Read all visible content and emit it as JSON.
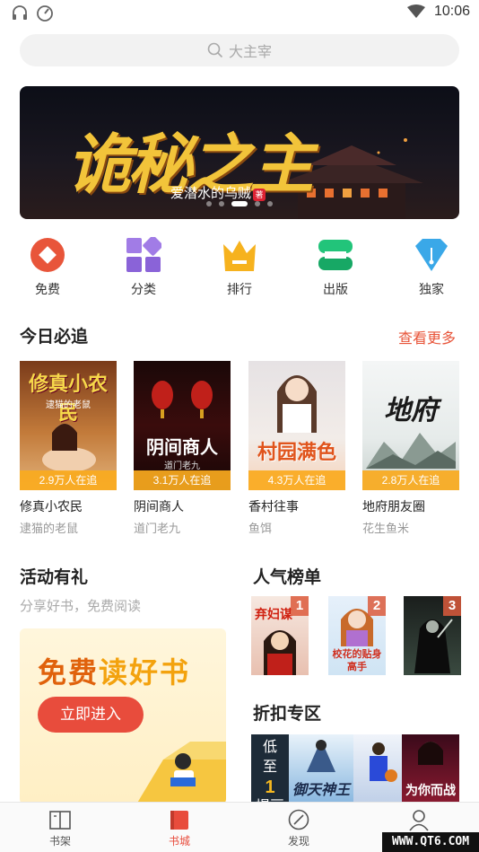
{
  "status_bar": {
    "time": "10:06"
  },
  "search": {
    "placeholder": "大主宰"
  },
  "banner": {
    "title": "诡秘之主",
    "author": "爱潜水的乌贼",
    "badge": "著",
    "slide_count": 5,
    "active_slide": 3
  },
  "quick_nav": [
    {
      "label": "免费",
      "icon": "free-icon",
      "color": "#e8553a"
    },
    {
      "label": "分类",
      "icon": "category-icon",
      "color": "#9a6fe0"
    },
    {
      "label": "排行",
      "icon": "crown-icon",
      "color": "#f5b020"
    },
    {
      "label": "出版",
      "icon": "publish-icon",
      "color": "#22c47a"
    },
    {
      "label": "独家",
      "icon": "exclusive-icon",
      "color": "#3aa8e8"
    }
  ],
  "today": {
    "title": "今日必追",
    "more": "查看更多",
    "books": [
      {
        "name": "修真小农民",
        "author": "逮猫的老鼠",
        "readers": "2.9万人在追",
        "cover_title": "修真小农民",
        "cover_sub": "逮猫的老鼠"
      },
      {
        "name": "阴间商人",
        "author": "道门老九",
        "readers": "3.1万人在追",
        "cover_title": "阴间商人",
        "cover_sub": "道门老九"
      },
      {
        "name": "香村往事",
        "author": "鱼饵",
        "readers": "4.3万人在追",
        "cover_title": "村园满色"
      },
      {
        "name": "地府朋友圈",
        "author": "花生鱼米",
        "readers": "2.8万人在追",
        "cover_title": "地府"
      }
    ]
  },
  "activity": {
    "title": "活动有礼",
    "subtitle": "分享好书，免费阅读",
    "card_head_1": "免费",
    "card_head_2": "读好书",
    "button": "立即进入"
  },
  "ranking": {
    "title": "人气榜单",
    "items": [
      {
        "rank": "1",
        "cover_title": "弃妇谋"
      },
      {
        "rank": "2",
        "cover_title": "校花的贴身高手"
      },
      {
        "rank": "3",
        "cover_title": ""
      }
    ]
  },
  "discount": {
    "title": "折扣专区",
    "label_1": "低",
    "label_2": "至",
    "label_num": "1",
    "label_3": "提豆",
    "cover_titles": [
      "御天神王",
      "",
      "为你而战"
    ]
  },
  "tabs": [
    {
      "label": "书架",
      "icon": "bookshelf-icon"
    },
    {
      "label": "书城",
      "icon": "bookstore-icon",
      "active": true
    },
    {
      "label": "发现",
      "icon": "discover-icon"
    },
    {
      "label": "我的",
      "icon": "profile-icon"
    }
  ],
  "watermark": "WWW.QT6.COM"
}
